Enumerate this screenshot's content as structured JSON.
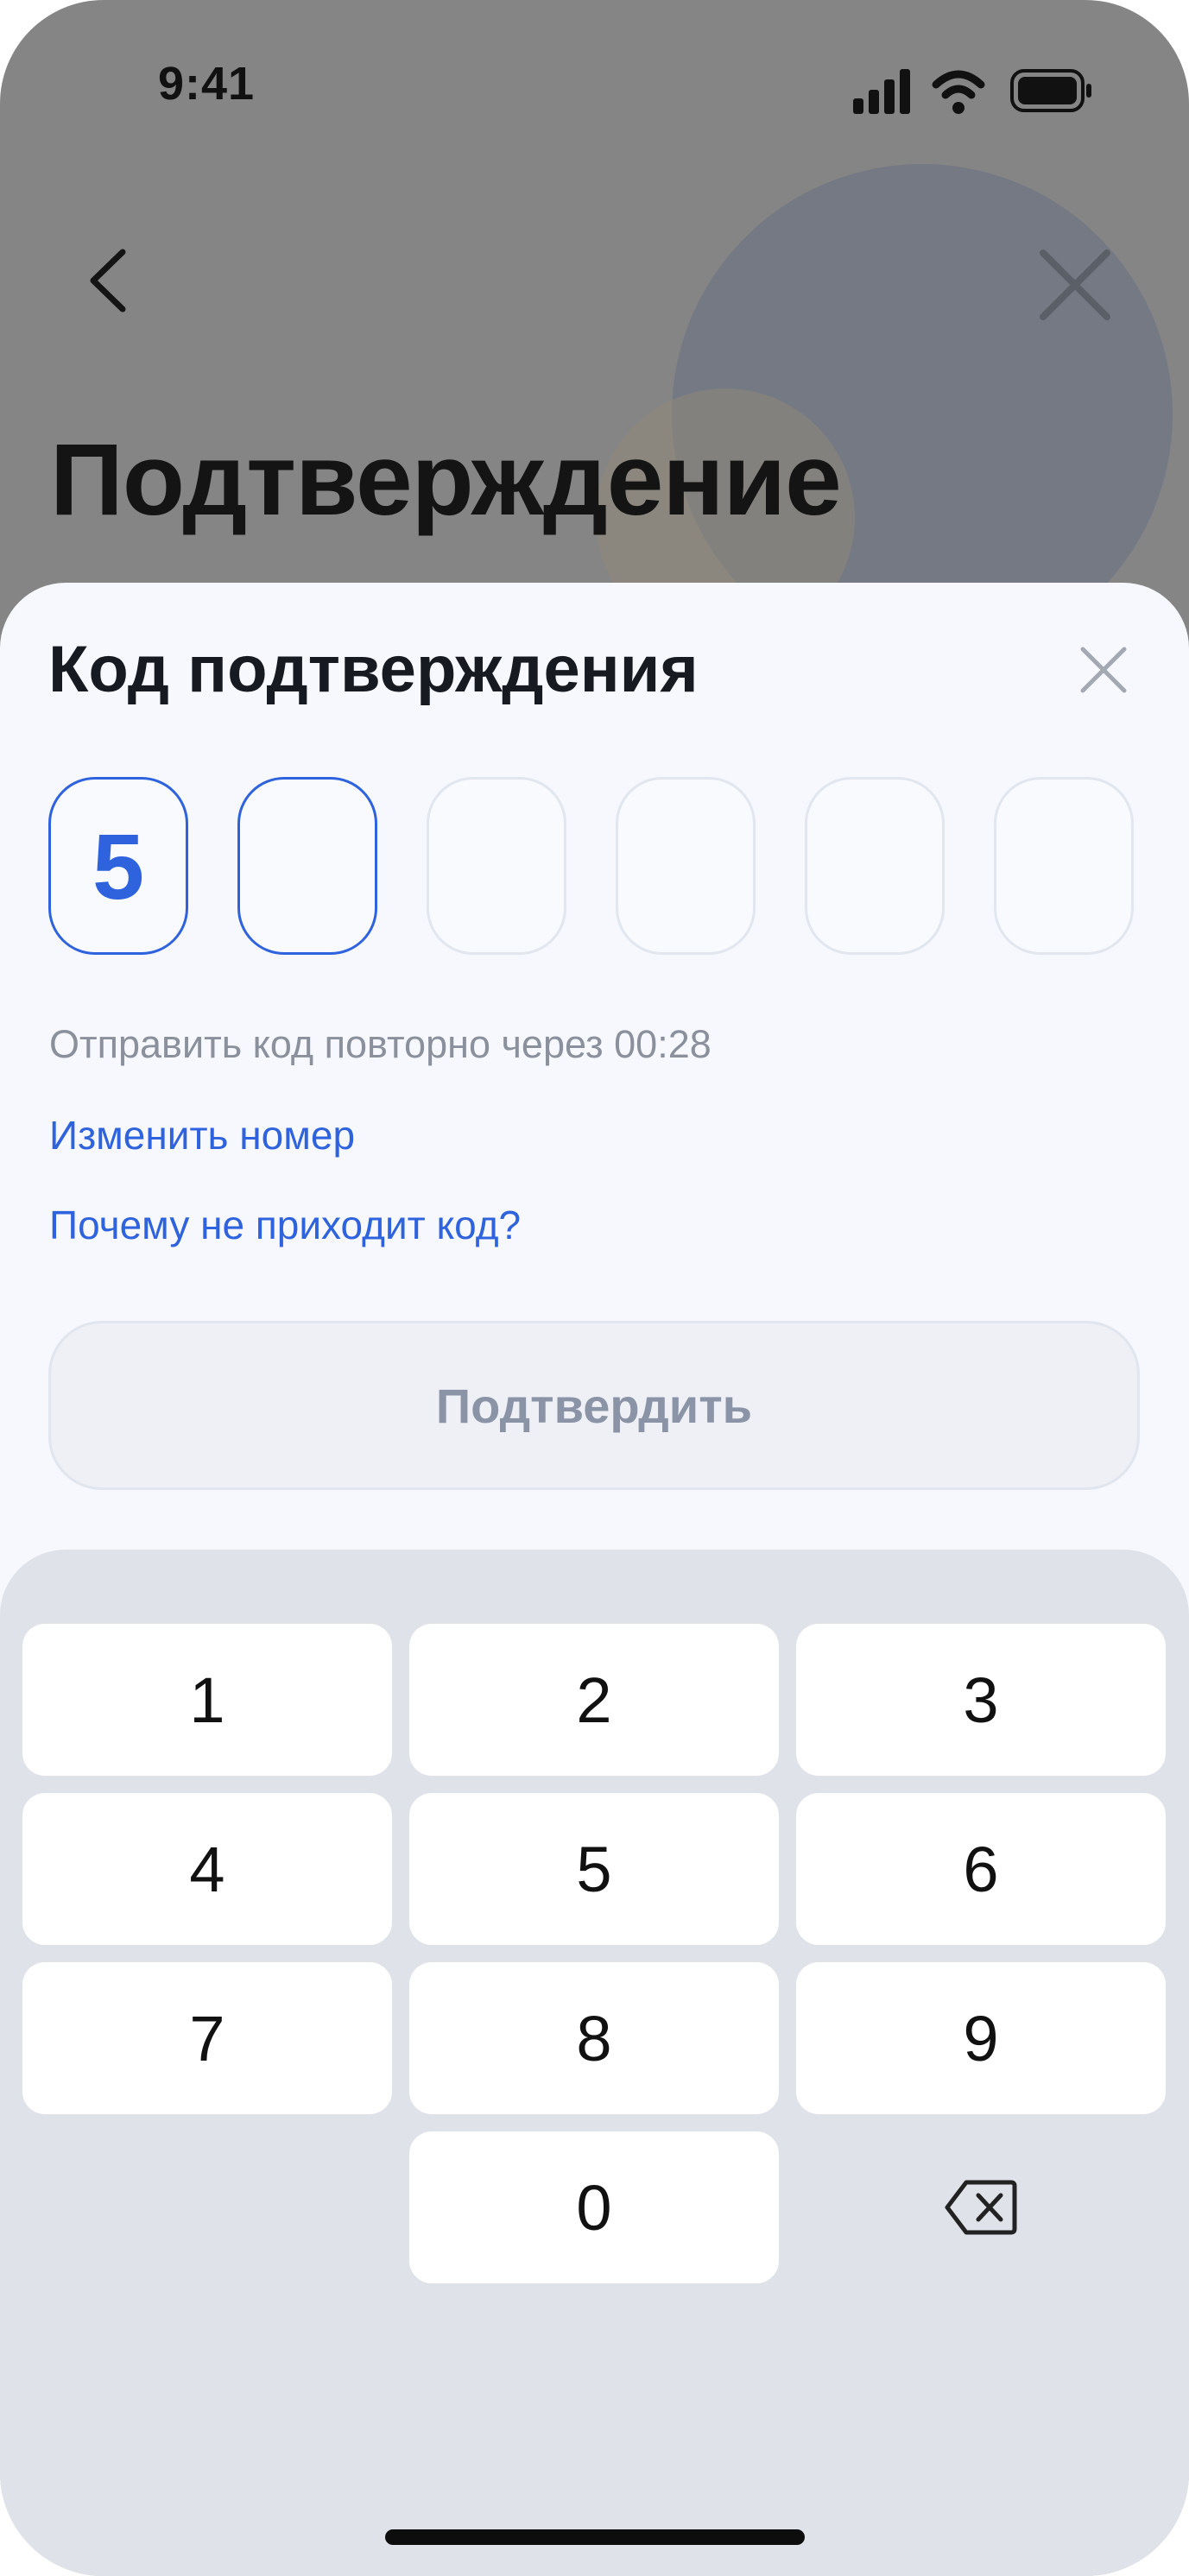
{
  "status_bar": {
    "time": "9:41",
    "icons": [
      "signal-icon",
      "wifi-icon",
      "battery-icon"
    ]
  },
  "background_screen": {
    "title": "Подтверждение",
    "back_icon": "chevron-left-icon",
    "close_icon": "close-icon"
  },
  "sheet": {
    "title": "Код подтверждения",
    "close_icon": "close-icon",
    "code": {
      "length": 6,
      "entered": [
        "5",
        "",
        "",
        "",
        "",
        ""
      ],
      "active_index": 1
    },
    "resend_text": "Отправить код повторно через 00:28",
    "change_number_link": "Изменить номер",
    "why_no_code_link": "Почему не приходит код?",
    "confirm_button": "Подтвердить"
  },
  "keypad": {
    "keys": [
      "1",
      "2",
      "3",
      "4",
      "5",
      "6",
      "7",
      "8",
      "9",
      "0"
    ],
    "backspace_icon": "backspace-icon"
  },
  "colors": {
    "accent": "#2f63dd",
    "dim_overlay": "#858585",
    "sheet_bg": "#f6f8fd",
    "keypad_bg": "#dfe2e8",
    "disabled_text": "#8b94a6"
  }
}
